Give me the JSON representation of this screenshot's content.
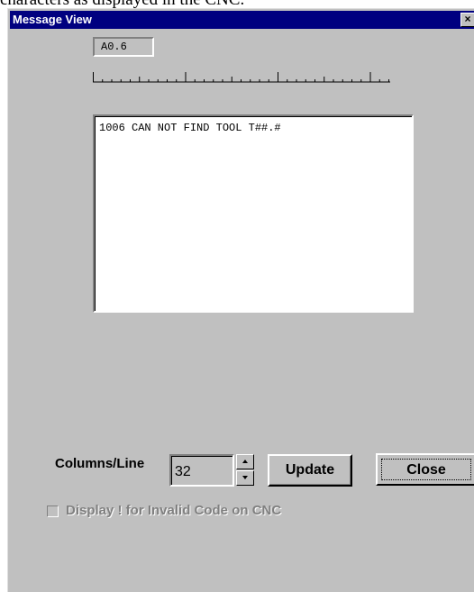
{
  "document": {
    "caption": "characters as displayed in the CNC."
  },
  "window": {
    "title": "Message View",
    "close_glyph": "×"
  },
  "address_label": "A0.6",
  "message_text": "1006 CAN NOT FIND TOOL T##.#",
  "columns": {
    "label": "Columns/Line",
    "value": "32"
  },
  "buttons": {
    "update": "Update",
    "close": "Close"
  },
  "option": {
    "label": "Display ! for Invalid Code on CNC",
    "checked": false,
    "enabled": false
  },
  "icons": {
    "close": "close-icon",
    "spin_up": "arrow-up-icon",
    "spin_down": "arrow-down-icon"
  },
  "colors": {
    "titlebar": "#000080",
    "face": "#c0c0c0",
    "disabled_text": "#808080"
  }
}
